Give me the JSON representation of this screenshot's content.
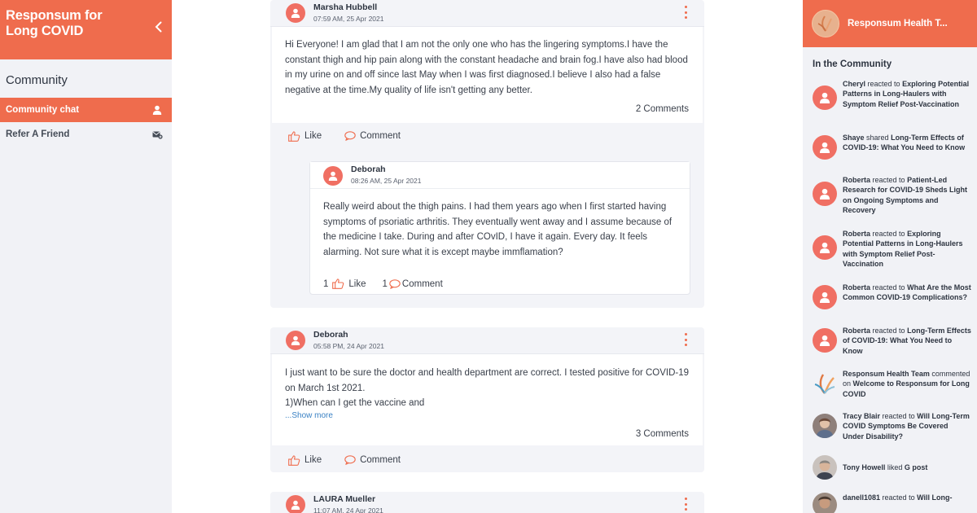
{
  "sidebar": {
    "brand_title": "Responsum for Long COVID",
    "section_title": "Community",
    "items": [
      {
        "label": "Community chat",
        "icon": "user-icon"
      },
      {
        "label": "Refer A Friend",
        "icon": "mail-plus-icon"
      }
    ]
  },
  "feed": {
    "posts": [
      {
        "author": "Marsha Hubbell",
        "time": "07:59 AM, 25 Apr 2021",
        "text": "Hi Everyone! I am glad that I am not the only one who has the lingering symptoms.I have the constant thigh and hip pain along with the constant headache and brain fog.I have also had blood in my urine on and off since last May when I was first diagnosed.I believe I also had a false negative at the time.My quality of life isn't getting any better.",
        "comments": "2 Comments",
        "like_label": "Like",
        "comment_label": "Comment",
        "reply": {
          "author": "Deborah",
          "time": "08:26 AM, 25 Apr 2021",
          "text": "Really weird about the thigh pains. I had them years ago when I first started having symptoms of psoriatic arthritis. They eventually went away and  I assume because of the medicine I take. During and after COvID, I have it again. Every day. It feels alarming. Not sure what it is except maybe immflamation?",
          "like_count": "1",
          "like_label": "Like",
          "comment_count": "1",
          "comment_label": "Comment"
        }
      },
      {
        "author": "Deborah",
        "time": "05:58 PM, 24 Apr 2021",
        "lines": [
          "I just want to be sure the doctor and health department are correct. I tested positive for COVID-19 on March 1st 2021.",
          " 1)When can I get the vaccine and"
        ],
        "show_more": "...Show more",
        "comments": "3 Comments",
        "like_label": "Like",
        "comment_label": "Comment"
      },
      {
        "author": "LAURA Mueller",
        "time": "11:07 AM, 24 Apr 2021"
      }
    ]
  },
  "right_panel": {
    "title": "Responsum Health T...",
    "section_title": "In the Community",
    "activities": [
      {
        "actor": "Cheryl",
        "verb": "reacted to",
        "target": "Exploring Potential Patterns in Long-Haulers with Symptom Relief Post-Vaccination",
        "avatar": "user-icon"
      },
      {
        "actor": "Shaye",
        "verb": "shared",
        "target": "Long-Term Effects of COVID-19: What You Need to Know",
        "avatar": "user-icon"
      },
      {
        "actor": "Roberta",
        "verb": "reacted to",
        "target": "Patient-Led Research for COVID-19 Sheds Light on Ongoing Symptoms and Recovery",
        "avatar": "user-icon"
      },
      {
        "actor": "Roberta",
        "verb": "reacted to",
        "target": "Exploring Potential Patterns in Long-Haulers with Symptom Relief Post-Vaccination",
        "avatar": "user-icon"
      },
      {
        "actor": "Roberta",
        "verb": "reacted to",
        "target": "What Are the Most Common COVID-19 Complications?",
        "avatar": "user-icon"
      },
      {
        "actor": "Roberta",
        "verb": "reacted to",
        "target": "Long-Term Effects of COVID-19: What You Need to Know",
        "avatar": "user-icon"
      },
      {
        "actor": "Responsum Health Team",
        "verb": "commented on",
        "target": "Welcome to Responsum for Long COVID",
        "avatar": "responsum-logo-icon"
      },
      {
        "actor": "Tracy Blair",
        "verb": "reacted to",
        "target": "Will Long-Term COVID Symptoms Be Covered Under Disability?",
        "avatar": "user-photo"
      },
      {
        "actor": "Tony Howell",
        "verb": "liked",
        "target": "G post",
        "avatar": "user-photo"
      },
      {
        "actor": "danell1081",
        "verb": "reacted to",
        "target": "Will Long-",
        "avatar": "user-photo"
      }
    ]
  },
  "colors": {
    "accent": "#ef6c4d",
    "avatar": "#f06f63",
    "link": "#3b82c4",
    "panel_bg": "#f1f2f6"
  }
}
